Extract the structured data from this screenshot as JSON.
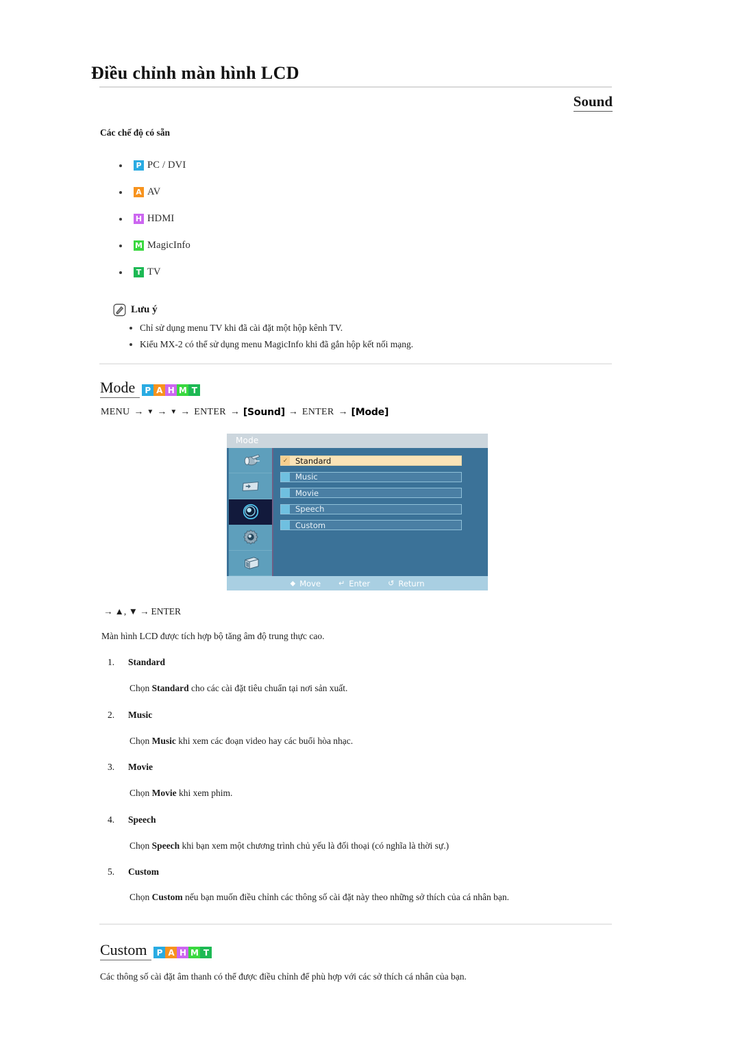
{
  "header": {
    "doc_title": "Điều chỉnh màn hình LCD",
    "section_label": "Sound"
  },
  "available_modes": {
    "heading": "Các chế độ có sẵn",
    "items": [
      {
        "badge": "P",
        "label": "PC / DVI",
        "color": "#29ABE2"
      },
      {
        "badge": "A",
        "label": "AV",
        "color": "#F7931E"
      },
      {
        "badge": "H",
        "label": "HDMI",
        "color": "#CC66F0"
      },
      {
        "badge": "M",
        "label": "MagicInfo",
        "color": "#39D83F"
      },
      {
        "badge": "T",
        "label": "TV",
        "color": "#1DB954"
      }
    ]
  },
  "note": {
    "title": "Lưu ý",
    "icon": "note-pencil-icon",
    "items": [
      "Chỉ sử dụng menu TV khi đã cài đặt một hộp kênh TV.",
      "Kiểu MX-2 có thể sử dụng menu MagicInfo khi đã gắn hộp kết nối mạng."
    ]
  },
  "mode_section": {
    "heading": "Mode",
    "badges": [
      {
        "badge": "P",
        "color": "#29ABE2"
      },
      {
        "badge": "A",
        "color": "#F7931E"
      },
      {
        "badge": "H",
        "color": "#CC66F0"
      },
      {
        "badge": "M",
        "color": "#39D83F"
      },
      {
        "badge": "T",
        "color": "#1DB954"
      }
    ],
    "menu_path": {
      "menu": "MENU",
      "down1": "▼",
      "down2": "▼",
      "enter1": "ENTER",
      "sound_key": "[Sound]",
      "enter2": "ENTER",
      "mode_key": "[Mode]",
      "arrow": "→"
    },
    "nav_line": {
      "arrow": "→",
      "up": "▲",
      "comma": ",",
      "down": "▼",
      "enter": "ENTER"
    },
    "intro": "Màn hình LCD được tích hợp bộ tăng âm độ trung thực cao.",
    "items": [
      {
        "number": "1.",
        "title": "Standard",
        "desc_pre": "Chọn ",
        "desc_bold": "Standard",
        "desc_post": " cho các cài đặt tiêu chuẩn tại nơi sản xuất."
      },
      {
        "number": "2.",
        "title": "Music",
        "desc_pre": "Chọn ",
        "desc_bold": "Music",
        "desc_post": " khi xem các đoạn video hay các buổi hòa nhạc."
      },
      {
        "number": "3.",
        "title": "Movie",
        "desc_pre": "Chọn ",
        "desc_bold": "Movie",
        "desc_post": " khi xem phim."
      },
      {
        "number": "4.",
        "title": "Speech",
        "desc_pre": "Chọn ",
        "desc_bold": "Speech",
        "desc_post": " khi bạn xem một chương trình chủ yếu là đối thoại (có nghĩa là thời sự.)"
      },
      {
        "number": "5.",
        "title": "Custom",
        "desc_pre": "Chọn ",
        "desc_bold": "Custom",
        "desc_post": " nếu bạn muốn điều chỉnh các thông số cài đặt này theo những sở thích của cá nhân bạn."
      }
    ]
  },
  "osd": {
    "title": "Mode",
    "sidebar_icons": [
      "picture-icon",
      "input-source-icon",
      "sound-icon",
      "setup-gear-icon",
      "multi-control-icon"
    ],
    "rows": [
      {
        "label": "Standard",
        "selected": true,
        "check": "✓"
      },
      {
        "label": "Music",
        "selected": false
      },
      {
        "label": "Movie",
        "selected": false
      },
      {
        "label": "Speech",
        "selected": false
      },
      {
        "label": "Custom",
        "selected": false
      }
    ],
    "footer": [
      {
        "icon": "move-updown-icon",
        "glyph": "⬥",
        "label": "Move"
      },
      {
        "icon": "enter-key-icon",
        "glyph": "↵",
        "label": "Enter"
      },
      {
        "icon": "return-arrow-icon",
        "glyph": "↺",
        "label": "Return"
      }
    ],
    "colors": {
      "title_bar": "#ccd6dd",
      "body": "#3b7298",
      "sidebar": "#5e9fbc",
      "sidebar_active": "#121a3c",
      "row_selected": "#fbe3b7",
      "row_normal": "#4a7fa4",
      "footer": "#a9cfe2"
    }
  },
  "custom_section": {
    "heading": "Custom",
    "badges": [
      {
        "badge": "P",
        "color": "#29ABE2"
      },
      {
        "badge": "A",
        "color": "#F7931E"
      },
      {
        "badge": "H",
        "color": "#CC66F0"
      },
      {
        "badge": "M",
        "color": "#39D83F"
      },
      {
        "badge": "T",
        "color": "#1DB954"
      }
    ],
    "body": "Các thông số cài đặt âm thanh có thể được điều chỉnh để phù hợp với các sở thích cá nhân của bạn."
  }
}
